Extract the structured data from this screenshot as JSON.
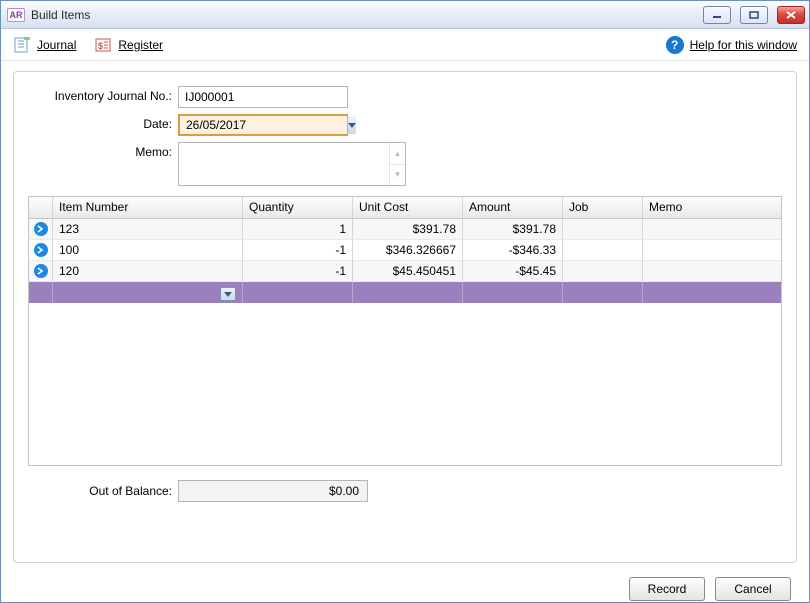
{
  "window": {
    "app_code": "AR",
    "title": "Build Items"
  },
  "toolbar": {
    "journal": "Journal",
    "register": "Register",
    "help": "Help for this window"
  },
  "form": {
    "inventory_label": "Inventory Journal No.:",
    "inventory_value": "IJ000001",
    "date_label": "Date:",
    "date_value": "26/05/2017",
    "memo_label": "Memo:",
    "memo_value": ""
  },
  "grid": {
    "headers": {
      "item": "Item Number",
      "qty": "Quantity",
      "cost": "Unit Cost",
      "amount": "Amount",
      "job": "Job",
      "memo": "Memo"
    },
    "rows": [
      {
        "item": "123",
        "qty": "1",
        "cost": "$391.78",
        "amount": "$391.78",
        "job": "",
        "memo": ""
      },
      {
        "item": "100",
        "qty": "-1",
        "cost": "$346.326667",
        "amount": "-$346.33",
        "job": "",
        "memo": ""
      },
      {
        "item": "120",
        "qty": "-1",
        "cost": "$45.450451",
        "amount": "-$45.45",
        "job": "",
        "memo": ""
      }
    ]
  },
  "balance": {
    "label": "Out of Balance:",
    "value": "$0.00"
  },
  "footer": {
    "record": "Record",
    "cancel": "Cancel"
  }
}
